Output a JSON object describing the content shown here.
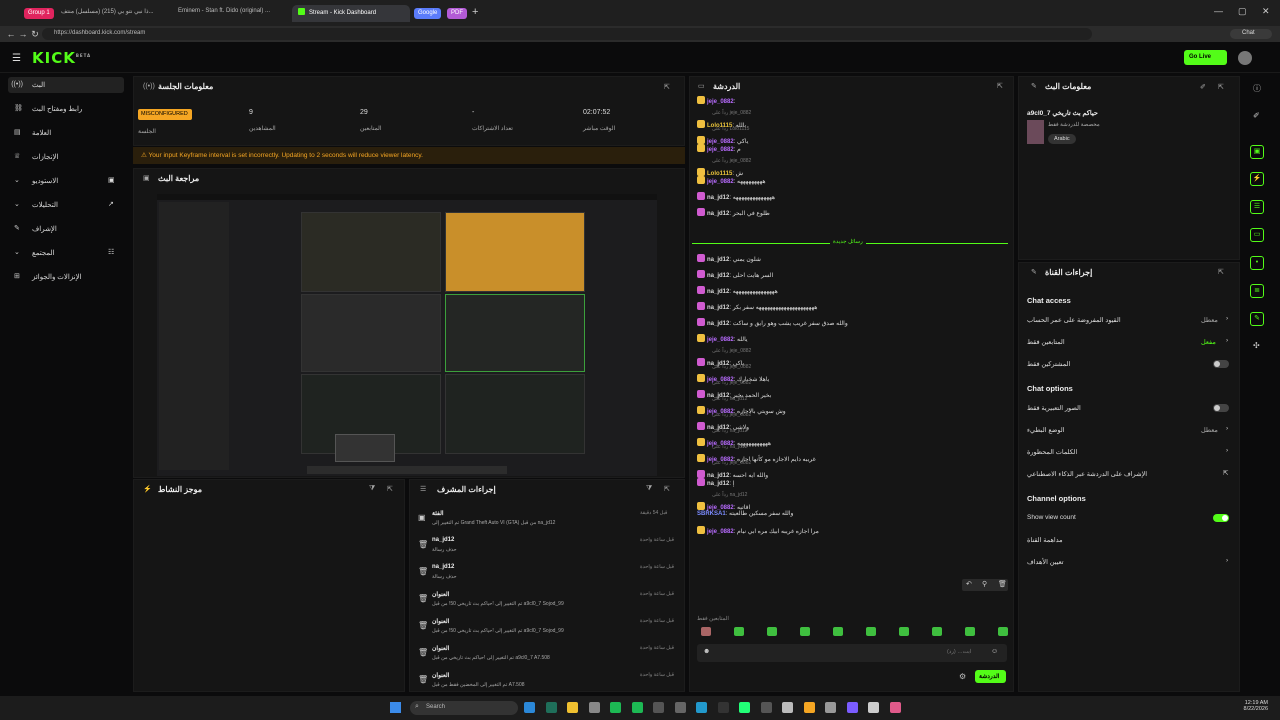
{
  "browser": {
    "groups": [
      {
        "label": "Group 1",
        "color": "#e0245e"
      },
      {
        "label": "Google",
        "color": "#5b7cfa"
      },
      {
        "label": "PDF",
        "color": "#b35bd6"
      }
    ],
    "tabs": [
      {
        "label": "ذا نبي نتو بي (215) (مسلسل) منتف...",
        "active": false
      },
      {
        "label": "Eminem - Stan ft. Dido (original) ...",
        "active": false
      },
      {
        "label": "Stream - Kick Dashboard",
        "active": true
      }
    ],
    "url": "https://dashboard.kick.com/stream",
    "chat_label": "Chat"
  },
  "header": {
    "logo": "KICK",
    "logo_sup": "BETA",
    "go_live": "Go Live"
  },
  "sidebar": {
    "items": [
      {
        "label": "البث",
        "icon": "broadcast-icon",
        "active": true
      },
      {
        "label": "رابط ومفتاح البث",
        "icon": "link-icon",
        "active": false
      },
      {
        "label": "العلامة",
        "icon": "list-icon",
        "active": false
      },
      {
        "label": "الإنجازات",
        "icon": "trophy-icon",
        "active": false
      },
      {
        "label": "الاستوديو",
        "icon": "studio-icon",
        "active": false
      },
      {
        "label": "التحليلات",
        "icon": "chart-icon",
        "active": false
      },
      {
        "label": "الإشراف",
        "icon": "wrench-icon",
        "active": false
      },
      {
        "label": "المجتمع",
        "icon": "community-icon",
        "active": false
      },
      {
        "label": "الإنزالات والجوائز",
        "icon": "gift-icon",
        "active": false
      }
    ]
  },
  "session": {
    "title": "معلومات الجلسة",
    "status": "MISCONFIGURED",
    "status_label": "الجلسة",
    "viewers": "9",
    "viewers_label": "المشاهدين",
    "followers": "29",
    "followers_label": "المتابعين",
    "subs": "-",
    "subs_label": "تعداد الاشتراكات",
    "uptime": "02:07:52",
    "uptime_label": "الوقت مباشر"
  },
  "warning": "Your input Keyframe interval is set incorrectly. Updating to 2 seconds will reduce viewer latency.",
  "preview": {
    "title": "مراجعة البث"
  },
  "activity": {
    "title": "موجز النشاط"
  },
  "modactions": {
    "title": "إجراءات المشرف",
    "rows": [
      {
        "title": "الفئة",
        "desc": "تم التغيير إلى Grand Theft Auto VI (GTA) من قبل na_jd12",
        "time": "قبل 54 دقيقة"
      },
      {
        "title": "na_jd12",
        "desc": "حذف رسالة",
        "time": "قبل ساعة واحدة"
      },
      {
        "title": "na_jd12",
        "desc": "حذف رسالة",
        "time": "قبل ساعة واحدة"
      },
      {
        "title": "العنوان",
        "desc": "تم التغيير إلى !حياكم بث تاريخي 50! من قبل a9cl0_7 Sojod_99",
        "time": "قبل ساعة واحدة"
      },
      {
        "title": "العنوان",
        "desc": "تم التغيير إلى !حياكم بث تاريخي 50! من قبل a9cl0_7 Sojod_99",
        "time": "قبل ساعة واحدة"
      },
      {
        "title": "العنوان",
        "desc": "تم التغيير إلى !حياكم بث تاريخي من قبل a9cl0_7 A7.508",
        "time": "قبل ساعة واحدة"
      },
      {
        "title": "العنوان",
        "desc": "تم التغيير إلى المخضين فقط من قبل A7.508",
        "time": "قبل ساعة واحدة"
      }
    ]
  },
  "chat": {
    "title": "الدردشة",
    "new_messages": "رسائل جديدة",
    "lines": [
      {
        "user": "jeje_0882",
        "text": "",
        "color": "#b86bff",
        "badge": "#f0c040",
        "reply": ""
      },
      {
        "user": "Lolo1115",
        "text": "يالله",
        "color": "#e8c23a",
        "badge": "#f0c040",
        "reply": "رداً على jeje_0882"
      },
      {
        "user": "jeje_0882",
        "text": "ياكي",
        "color": "#b86bff",
        "badge": "#f0c040",
        "reply": "رداً على Lolo1115"
      },
      {
        "user": "jeje_0882",
        "text": "م",
        "color": "#b86bff",
        "badge": "#f0c040",
        "reply": ""
      },
      {
        "user": "Lolo1115",
        "text": "ش",
        "color": "#e8c23a",
        "badge": "#f0c040",
        "reply": "رداً على jeje_0882"
      },
      {
        "user": "jeje_0882",
        "text": "هههههههههه",
        "color": "#b86bff",
        "badge": "#f0c040",
        "reply": ""
      },
      {
        "user": "na_jd12",
        "text": "ههههههههههههههه",
        "color": "#d8d8d8",
        "badge": "#d05bd0",
        "reply": ""
      },
      {
        "user": "na_jd12",
        "text": "طلوع في البحر",
        "color": "#d8d8d8",
        "badge": "#d05bd0",
        "reply": ""
      },
      {
        "user": "na_jd12",
        "text": "شلون يمني",
        "color": "#d8d8d8",
        "badge": "#d05bd0",
        "reply": ""
      },
      {
        "user": "na_jd12",
        "text": "السر هايت احلى",
        "color": "#d8d8d8",
        "badge": "#d05bd0",
        "reply": ""
      },
      {
        "user": "na_jd12",
        "text": "هههههههههههههههه",
        "color": "#d8d8d8",
        "badge": "#d05bd0",
        "reply": ""
      },
      {
        "user": "na_jd12",
        "text": "هههههههههههههههههههههه سفر بكر",
        "color": "#d8d8d8",
        "badge": "#d05bd0",
        "reply": ""
      },
      {
        "user": "na_jd12",
        "text": "والله صدق سفر غريب يشب وهو رايق و ساكت",
        "color": "#d8d8d8",
        "badge": "#d05bd0",
        "reply": ""
      },
      {
        "user": "jeje_0882",
        "text": "يالله",
        "color": "#b86bff",
        "badge": "#f0c040",
        "reply": ""
      },
      {
        "user": "na_jd12",
        "text": "ياكي",
        "color": "#d8d8d8",
        "badge": "#d05bd0",
        "reply": "رداً على jeje_0882"
      },
      {
        "user": "jeje_0882",
        "text": "ياهلا شخبارك",
        "color": "#b86bff",
        "badge": "#f0c040",
        "reply": "رداً على jeje_0882"
      },
      {
        "user": "na_jd12",
        "text": "بخير الحمد بخير",
        "color": "#d8d8d8",
        "badge": "#d05bd0",
        "reply": "رداً على jeje_0882"
      },
      {
        "user": "jeje_0882",
        "text": "وش سويتي بالاجازه",
        "color": "#b86bff",
        "badge": "#f0c040",
        "reply": "رداً على na_jd12"
      },
      {
        "user": "na_jd12",
        "text": "ولاشي",
        "color": "#d8d8d8",
        "badge": "#d05bd0",
        "reply": "رداً على jeje_0882"
      },
      {
        "user": "jeje_0882",
        "text": "هههههههههههه",
        "color": "#b86bff",
        "badge": "#f0c040",
        "reply": "رداً على na_jd12"
      },
      {
        "user": "jeje_0882",
        "text": "غريبه دايم الاجازه مو كأنها اجازه",
        "color": "#b86bff",
        "badge": "#f0c040",
        "reply": "رداً على na_jd12"
      },
      {
        "user": "na_jd12",
        "text": "والله ايه احسه",
        "color": "#d8d8d8",
        "badge": "#d05bd0",
        "reply": "رداً على jeje_0882"
      },
      {
        "user": "na_jd12",
        "text": "إ",
        "color": "#d8d8d8",
        "badge": "#d05bd0",
        "reply": ""
      },
      {
        "user": "jeje_0882",
        "text": "اقاتيه",
        "color": "#b86bff",
        "badge": "#f0c040",
        "reply": "رداً على na_jd12"
      },
      {
        "user": "SBRKSA1",
        "text": "والله سفر مسكين طالعيته",
        "color": "#7b8cff",
        "badge": "",
        "reply": ""
      },
      {
        "user": "jeje_0882",
        "text": "مرا اجازه غريبه ابيك مره ابي نيام",
        "color": "#b86bff",
        "badge": "#f0c040",
        "reply": ""
      }
    ],
    "followers_only": "المتابعين فقط",
    "input_placeholder": "ابت… (رد)",
    "send": "الدردشة"
  },
  "streaminfo": {
    "title": "معلومات البث",
    "channel_title": "a9cl0_7 حياكم بث تاريخي",
    "category": "مخصصة للدردشة فقط",
    "language": "Arabic"
  },
  "channelactions": {
    "title": "إجراءات القناة",
    "sections": [
      {
        "heading": "Chat access",
        "items": [
          {
            "label": "القيود المفروضة على عمر الحساب",
            "value": "معطل",
            "control": "chevron"
          },
          {
            "label": "المتابعين فقط",
            "value": "مفعل",
            "control": "chevron"
          },
          {
            "label": "المشتركين فقط",
            "value": "",
            "control": "toggle",
            "on": false
          }
        ]
      },
      {
        "heading": "Chat options",
        "items": [
          {
            "label": "الصور التعبيرية فقط",
            "value": "",
            "control": "toggle",
            "on": false
          },
          {
            "label": "الوضع البطيء",
            "value": "معطل",
            "control": "chevron"
          },
          {
            "label": "الكلمات المحظورة",
            "value": "",
            "control": "chevron"
          },
          {
            "label": "الإشراف على الدردشة عبر الذكاء الاصطناعي",
            "value": "",
            "control": "link"
          }
        ]
      },
      {
        "heading": "Channel options",
        "items": [
          {
            "label": "Show view count",
            "value": "",
            "control": "toggle",
            "on": true
          },
          {
            "label": "مداهمة القناة",
            "value": "",
            "control": ""
          },
          {
            "label": "تعيين الأهداف",
            "value": "",
            "control": "chevron"
          }
        ]
      }
    ]
  },
  "taskbar": {
    "search": "Search",
    "time": "12:19 AM",
    "date": "8/22/2026"
  },
  "colors": {
    "accent": "#53fc18",
    "warning": "#f5a623"
  }
}
